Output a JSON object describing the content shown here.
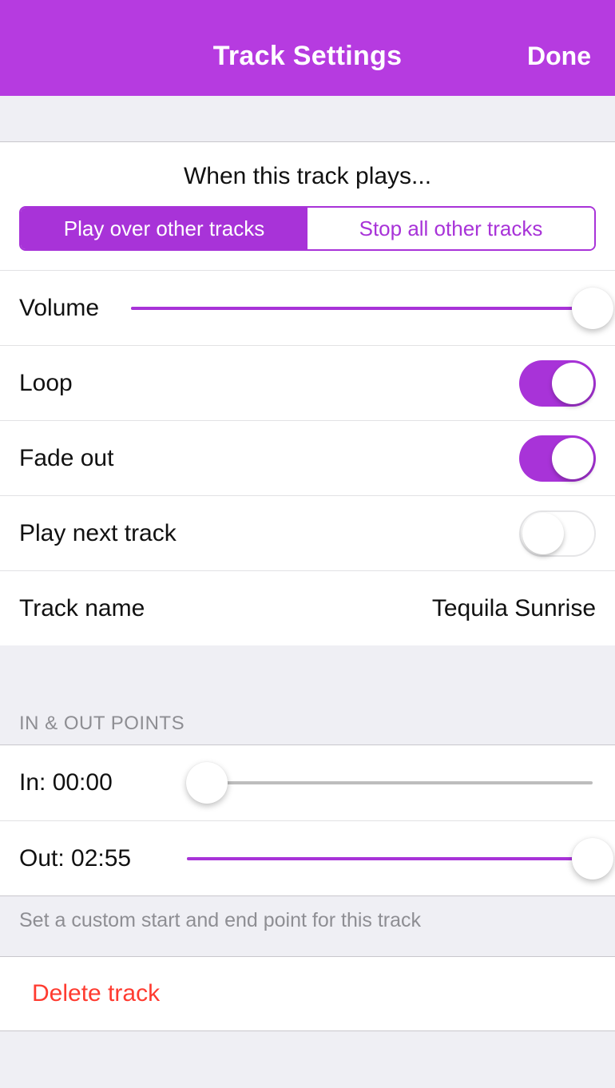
{
  "header": {
    "title": "Track Settings",
    "done": "Done"
  },
  "play_mode": {
    "heading": "When this track plays...",
    "option_over": "Play over other tracks",
    "option_stop": "Stop all other tracks",
    "selected": "over"
  },
  "volume": {
    "label": "Volume",
    "percent": 100
  },
  "loop": {
    "label": "Loop",
    "on": true
  },
  "fade_out": {
    "label": "Fade out",
    "on": true
  },
  "play_next": {
    "label": "Play next track",
    "on": false
  },
  "track_name": {
    "label": "Track name",
    "value": "Tequila Sunrise"
  },
  "in_out": {
    "section": "IN & OUT POINTS",
    "in_label": "In: 00:00",
    "in_percent": 0,
    "out_label": "Out: 02:55",
    "out_percent": 100,
    "note": "Set a custom start and end point for this track"
  },
  "delete": {
    "label": "Delete track"
  }
}
